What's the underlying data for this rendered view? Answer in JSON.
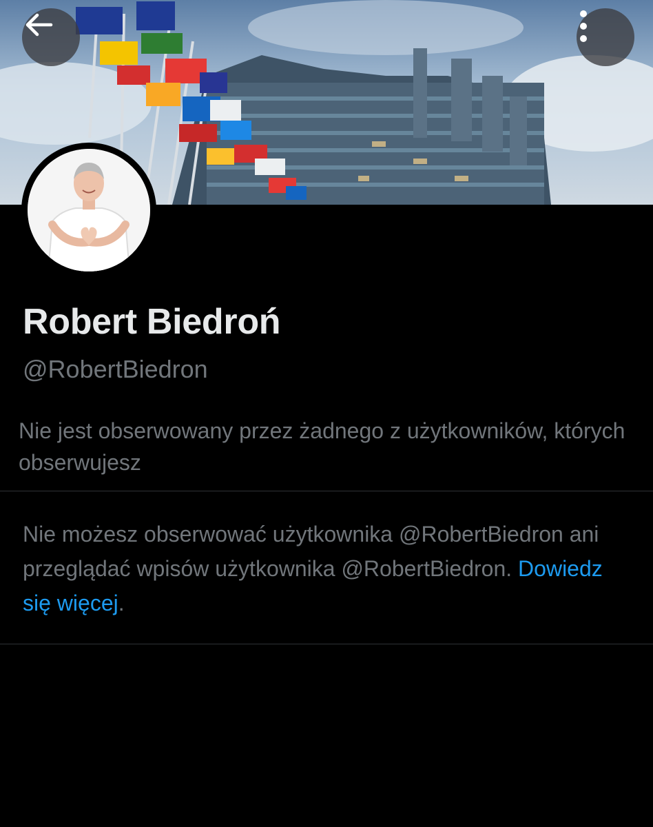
{
  "header": {
    "back_icon": "arrow-left-icon",
    "more_icon": "more-vertical-icon"
  },
  "profile": {
    "display_name": "Robert Biedroń",
    "handle": "@RobertBiedron",
    "followers_note": "Nie jest obserwowany przez żadnego z użytkowników, których obserwujesz"
  },
  "blocked": {
    "message_prefix": "Nie możesz obserwować użytkownika @RobertBiedron ani przeglądać wpisów użytkownika @RobertBiedron.",
    "learn_more_label": "Dowiedz się więcej",
    "suffix": "."
  },
  "colors": {
    "background": "#000000",
    "primary_text": "#e7e9ea",
    "secondary_text": "#71767b",
    "link": "#1d9bf0",
    "divider": "#2f3336"
  }
}
